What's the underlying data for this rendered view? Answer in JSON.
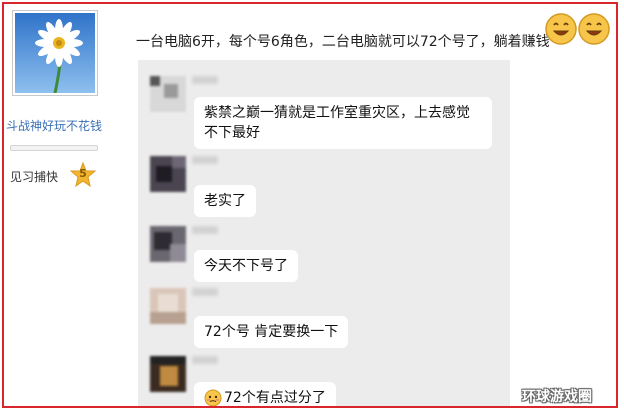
{
  "profile": {
    "username": "斗战神好玩不花钱",
    "rank_label": "见习捕快",
    "rank_level": "5"
  },
  "post": {
    "text": "一台电脑6开，每个号6角色，二台电脑就可以72个号了，躺着赚钱"
  },
  "chat": {
    "messages": [
      {
        "text": "紫禁之巅一猜就是工作室重灾区，上去感觉不下最好"
      },
      {
        "text": "老实了"
      },
      {
        "text": "今天不下号了"
      },
      {
        "text": "72个号 肯定要换一下"
      },
      {
        "text": "72个有点过分了"
      }
    ]
  },
  "watermark": "环球游戏圈",
  "colors": {
    "frame_border": "#d9262c",
    "username_link": "#3b6fb6",
    "chat_background": "#ececec",
    "bubble": "#ffffff",
    "rank_star": "#f2b530"
  }
}
